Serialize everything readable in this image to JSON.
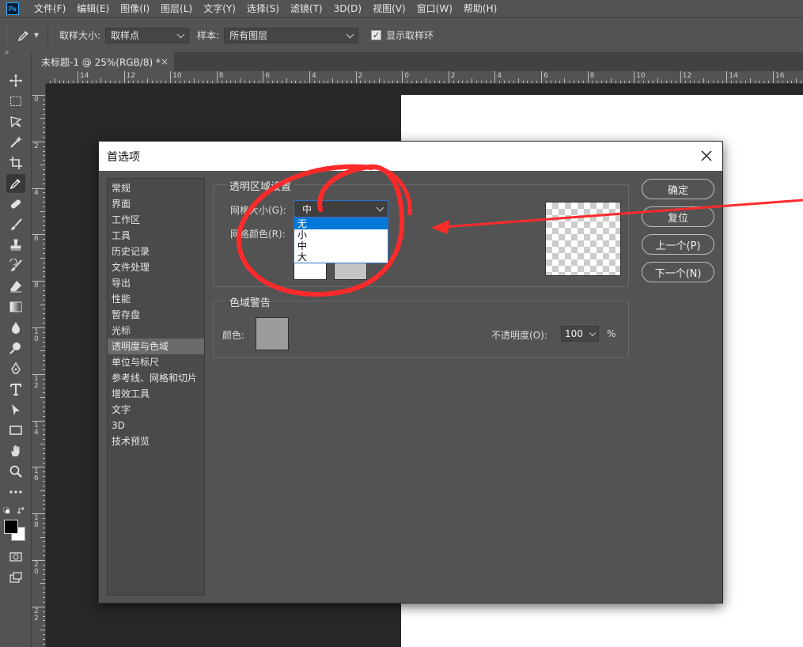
{
  "app": {
    "logo": "Ps"
  },
  "menubar": {
    "items": [
      "文件(F)",
      "编辑(E)",
      "图像(I)",
      "图层(L)",
      "文字(Y)",
      "选择(S)",
      "滤镜(T)",
      "3D(D)",
      "视图(V)",
      "窗口(W)",
      "帮助(H)"
    ]
  },
  "options_bar": {
    "sample_size_label": "取样大小:",
    "sample_size_value": "取样点",
    "sample_label": "样本:",
    "sample_value": "所有图层",
    "show_ring_label": "显示取样环",
    "show_ring_checked": true,
    "check_glyph": "✓"
  },
  "document_tab": {
    "title": "未标题-1 @ 25%(RGB/8) *",
    "close": "×"
  },
  "ruler": {
    "h_labels": [
      "14",
      "12",
      "10",
      "8",
      "6",
      "4",
      "2",
      "0",
      "2",
      "4",
      "6",
      "8",
      "10",
      "12",
      "14",
      "16"
    ],
    "v_labels": [
      "0",
      "2",
      "4",
      "6",
      "8",
      "1\n0",
      "1\n2",
      "1\n4",
      "1\n6",
      "1\n8",
      "2\n0",
      "2\n2"
    ]
  },
  "dialog": {
    "title": "首选项",
    "categories": [
      "常规",
      "界面",
      "工作区",
      "工具",
      "历史记录",
      "文件处理",
      "导出",
      "性能",
      "暂存盘",
      "光标",
      "透明度与色域",
      "单位与标尺",
      "参考线、网格和切片",
      "增效工具",
      "文字",
      "3D",
      "技术预览"
    ],
    "selected_category": 10,
    "transparency": {
      "group_title": "透明区域设置",
      "grid_size_label": "网格大小(G):",
      "grid_size_value": "中",
      "grid_size_options": [
        "无",
        "小",
        "中",
        "大"
      ],
      "highlighted_option": 0,
      "grid_colors_label": "网格颜色(R):"
    },
    "gamut": {
      "group_title": "色域警告",
      "color_label": "颜色:",
      "opacity_label": "不透明度(O):",
      "opacity_value": "100",
      "percent": "%"
    },
    "buttons": {
      "ok": "确定",
      "reset": "复位",
      "prev": "上一个(P)",
      "next": "下一个(N)"
    }
  },
  "colors": {
    "annotation_red": "#ff2a2a",
    "selection_blue": "#0078d7",
    "panel": "#535353"
  }
}
